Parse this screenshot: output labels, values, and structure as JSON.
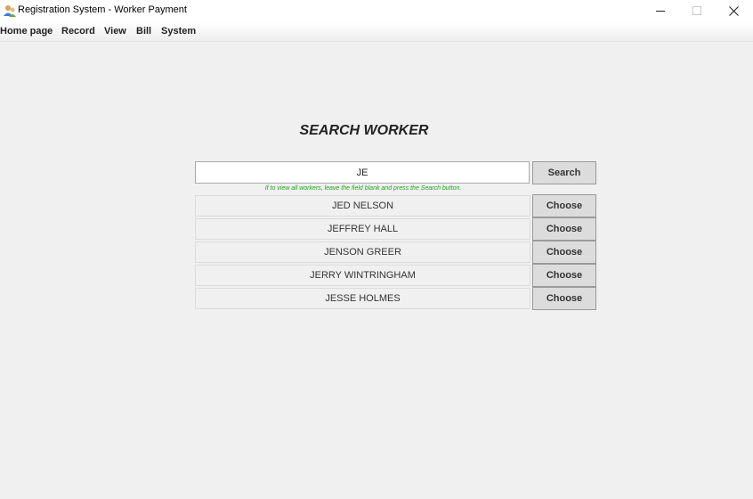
{
  "window": {
    "title": "Registration System - Worker Payment"
  },
  "menu": {
    "items": [
      "Home page",
      "Record",
      "View",
      "Bill",
      "System"
    ]
  },
  "main": {
    "heading": "SEARCH WORKER",
    "search": {
      "value": "JE",
      "button_label": "Search",
      "hint": "If to view all workers, leave the field blank and press the Search button."
    },
    "results": [
      {
        "name": "JED NELSON",
        "action": "Choose"
      },
      {
        "name": "JEFFREY HALL",
        "action": "Choose"
      },
      {
        "name": "JENSON GREER",
        "action": "Choose"
      },
      {
        "name": "JERRY WINTRINGHAM",
        "action": "Choose"
      },
      {
        "name": "JESSE HOLMES",
        "action": "Choose"
      }
    ]
  },
  "colors": {
    "hint": "#1ca61c",
    "background": "#f0f0f0",
    "button": "#dcdcdc"
  }
}
